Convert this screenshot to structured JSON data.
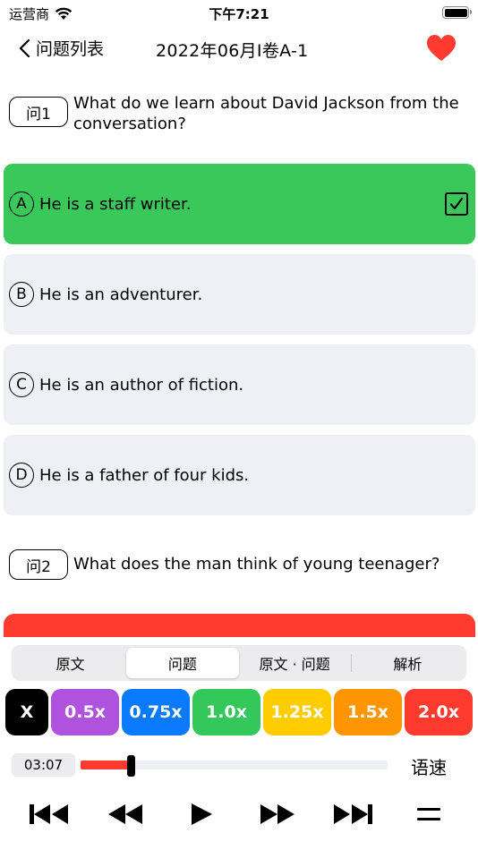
{
  "status": {
    "carrier": "运营商",
    "time": "下午7:21"
  },
  "nav": {
    "back_label": "问题列表",
    "title": "2022年06月I卷A-1"
  },
  "questions": [
    {
      "badge": "问1",
      "text": "What do we learn about David Jackson from the conversation?",
      "options": [
        {
          "letter": "A",
          "text": "He is a staff writer.",
          "selected": true
        },
        {
          "letter": "B",
          "text": "He is an adventurer.",
          "selected": false
        },
        {
          "letter": "C",
          "text": "He is an author of fiction.",
          "selected": false
        },
        {
          "letter": "D",
          "text": "He is a father of four kids.",
          "selected": false
        }
      ]
    },
    {
      "badge": "问2",
      "text": "What does the man think of young teenager?"
    }
  ],
  "tabs": [
    {
      "label": "原文",
      "active": false
    },
    {
      "label": "问题",
      "active": true
    },
    {
      "label": "原文 · 问题",
      "active": false
    },
    {
      "label": "解析",
      "active": false
    }
  ],
  "speeds": [
    {
      "label": "X",
      "color": "#000000"
    },
    {
      "label": "0.5x",
      "color": "#af52de"
    },
    {
      "label": "0.75x",
      "color": "#0a7aff"
    },
    {
      "label": "1.0x",
      "color": "#34c759"
    },
    {
      "label": "1.25x",
      "color": "#ffcc00"
    },
    {
      "label": "1.5x",
      "color": "#ff9500"
    },
    {
      "label": "2.0x",
      "color": "#ff3b30"
    }
  ],
  "player": {
    "current_time": "03:07",
    "progress": 0.163,
    "speed_label": "语速"
  },
  "colors": {
    "selected_option": "#3bc85b",
    "heart": "#ff3b30",
    "accent_red": "#ff3b30"
  },
  "icons": [
    "wifi-icon",
    "battery-icon",
    "back-chevron-icon",
    "heart-icon",
    "check-icon",
    "skip-back-icon",
    "rewind-icon",
    "play-icon",
    "fast-forward-icon",
    "skip-forward-icon",
    "menu-icon"
  ]
}
